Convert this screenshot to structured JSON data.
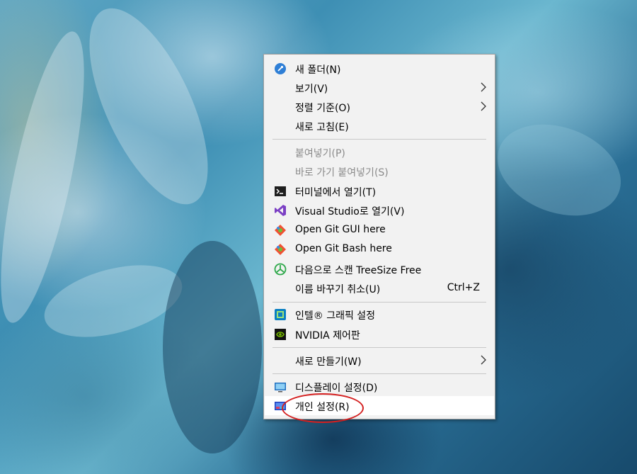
{
  "menu": {
    "items": [
      {
        "label": "새 폴더(N)",
        "icon": "new-folder-icon"
      },
      {
        "label": "보기(V)",
        "submenu": true
      },
      {
        "label": "정렬 기준(O)",
        "submenu": true
      },
      {
        "label": "새로 고침(E)"
      },
      {
        "label": "붙여넣기(P)",
        "disabled": true
      },
      {
        "label": "바로 가기 붙여넣기(S)",
        "disabled": true
      },
      {
        "label": "터미널에서 열기(T)",
        "icon": "terminal-icon"
      },
      {
        "label": "Visual Studio로 열기(V)",
        "icon": "visual-studio-icon"
      },
      {
        "label": "Open Git GUI here",
        "icon": "git-gui-icon"
      },
      {
        "label": "Open Git Bash here",
        "icon": "git-bash-icon"
      },
      {
        "label": "다음으로 스캔 TreeSize Free",
        "icon": "treesize-icon"
      },
      {
        "label": "이름 바꾸기 취소(U)",
        "shortcut": "Ctrl+Z"
      },
      {
        "label": "인텔® 그래픽 설정",
        "icon": "intel-graphics-icon"
      },
      {
        "label": "NVIDIA 제어판",
        "icon": "nvidia-icon"
      },
      {
        "label": "새로 만들기(W)",
        "submenu": true
      },
      {
        "label": "디스플레이 설정(D)",
        "icon": "display-settings-icon"
      },
      {
        "label": "개인 설정(R)",
        "icon": "personalize-icon",
        "highlighted": true
      }
    ]
  },
  "colors": {
    "annotation": "#d42020",
    "menu_background": "#f2f2f2",
    "disabled_text": "#8a8a8a"
  }
}
